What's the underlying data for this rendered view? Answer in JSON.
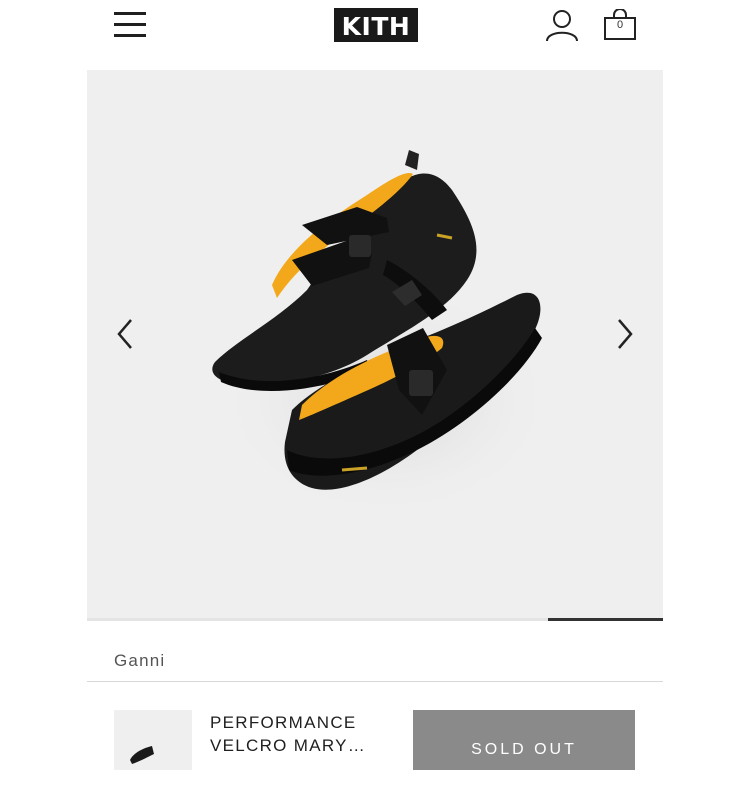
{
  "header": {
    "logo_text": "KITH",
    "menu_icon": "hamburger-menu-icon",
    "account_icon": "user-account-icon",
    "cart_icon": "shopping-bag-icon",
    "cart_count": "0"
  },
  "gallery": {
    "image_subject": "black Mary Jane sneakers with velcro straps and yellow lining",
    "prev_icon": "chevron-left-icon",
    "next_icon": "chevron-right-icon",
    "progress_fraction": 0.2,
    "progress_position": "last"
  },
  "product": {
    "vendor": "Ganni",
    "title": "PERFORMANCE VELCRO MARY…",
    "button_label": "SOLD OUT"
  },
  "colors": {
    "logo_bg": "#1a1a1a",
    "gallery_bg": "#efefef",
    "button_bg": "#8a8a8a",
    "accent_lining": "#f2a81a"
  }
}
